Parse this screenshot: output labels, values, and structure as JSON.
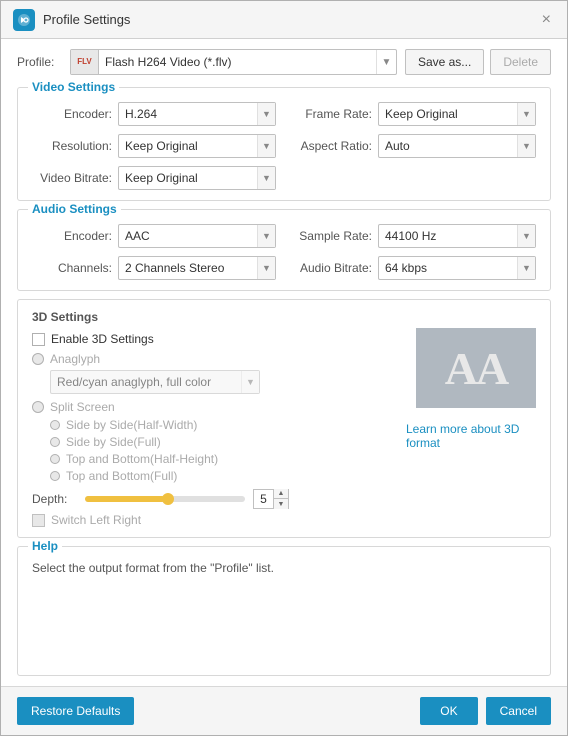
{
  "titleBar": {
    "title": "Profile Settings",
    "closeLabel": "×"
  },
  "profileRow": {
    "label": "Profile:",
    "iconLine1": "FLV",
    "iconLine2": "",
    "selectedProfile": "Flash H264 Video (*.flv)",
    "saveAsLabel": "Save as...",
    "deleteLabel": "Delete"
  },
  "videoSettings": {
    "sectionTitle": "Video Settings",
    "encoderLabel": "Encoder:",
    "encoderValue": "H.264",
    "frameRateLabel": "Frame Rate:",
    "frameRateValue": "Keep Original",
    "resolutionLabel": "Resolution:",
    "resolutionValue": "Keep Original",
    "aspectRatioLabel": "Aspect Ratio:",
    "aspectRatioValue": "Auto",
    "videoBitrateLabel": "Video Bitrate:",
    "videoBitrateValue": "Keep Original"
  },
  "audioSettings": {
    "sectionTitle": "Audio Settings",
    "encoderLabel": "Encoder:",
    "encoderValue": "AAC",
    "sampleRateLabel": "Sample Rate:",
    "sampleRateValue": "44100 Hz",
    "channelsLabel": "Channels:",
    "channelsValue": "2 Channels Stereo",
    "audioBitrateLabel": "Audio Bitrate:",
    "audioBitrateValue": "64 kbps"
  },
  "threeDSettings": {
    "sectionTitle": "3D Settings",
    "enableCheckboxLabel": "Enable 3D Settings",
    "anaglyphLabel": "Anaglyph",
    "anaglyphSelectValue": "Red/cyan anaglyph, full color",
    "splitScreenLabel": "Split Screen",
    "splitOptions": [
      "Side by Side(Half-Width)",
      "Side by Side(Full)",
      "Top and Bottom(Half-Height)",
      "Top and Bottom(Full)"
    ],
    "depthLabel": "Depth:",
    "depthValue": "5",
    "switchLeftRightLabel": "Switch Left Right",
    "learnMoreLabel": "Learn more about 3D format",
    "previewText": "AA"
  },
  "help": {
    "sectionTitle": "Help",
    "helpText": "Select the output format from the \"Profile\" list."
  },
  "footer": {
    "restoreLabel": "Restore Defaults",
    "okLabel": "OK",
    "cancelLabel": "Cancel"
  }
}
